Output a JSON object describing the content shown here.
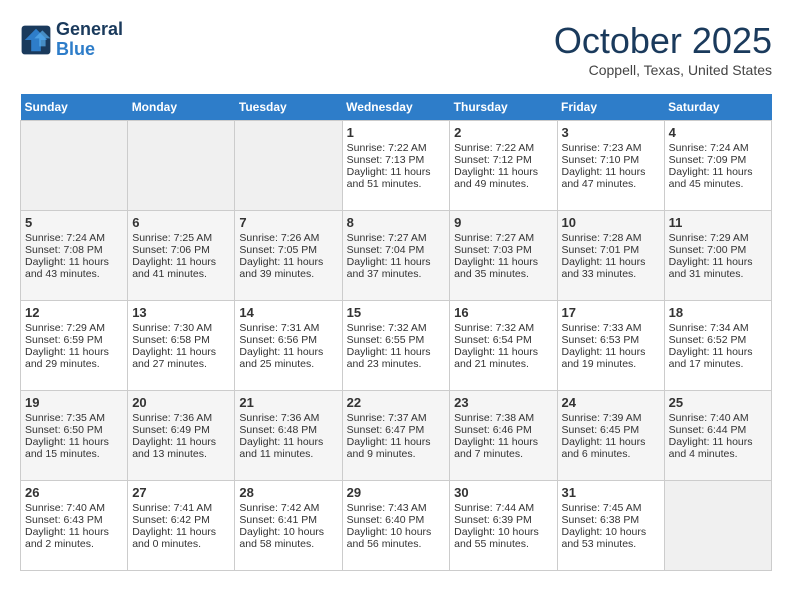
{
  "header": {
    "logo_line1": "General",
    "logo_line2": "Blue",
    "month": "October 2025",
    "location": "Coppell, Texas, United States"
  },
  "weekdays": [
    "Sunday",
    "Monday",
    "Tuesday",
    "Wednesday",
    "Thursday",
    "Friday",
    "Saturday"
  ],
  "weeks": [
    [
      {
        "day": "",
        "info": ""
      },
      {
        "day": "",
        "info": ""
      },
      {
        "day": "",
        "info": ""
      },
      {
        "day": "1",
        "info": "Sunrise: 7:22 AM\nSunset: 7:13 PM\nDaylight: 11 hours and 51 minutes."
      },
      {
        "day": "2",
        "info": "Sunrise: 7:22 AM\nSunset: 7:12 PM\nDaylight: 11 hours and 49 minutes."
      },
      {
        "day": "3",
        "info": "Sunrise: 7:23 AM\nSunset: 7:10 PM\nDaylight: 11 hours and 47 minutes."
      },
      {
        "day": "4",
        "info": "Sunrise: 7:24 AM\nSunset: 7:09 PM\nDaylight: 11 hours and 45 minutes."
      }
    ],
    [
      {
        "day": "5",
        "info": "Sunrise: 7:24 AM\nSunset: 7:08 PM\nDaylight: 11 hours and 43 minutes."
      },
      {
        "day": "6",
        "info": "Sunrise: 7:25 AM\nSunset: 7:06 PM\nDaylight: 11 hours and 41 minutes."
      },
      {
        "day": "7",
        "info": "Sunrise: 7:26 AM\nSunset: 7:05 PM\nDaylight: 11 hours and 39 minutes."
      },
      {
        "day": "8",
        "info": "Sunrise: 7:27 AM\nSunset: 7:04 PM\nDaylight: 11 hours and 37 minutes."
      },
      {
        "day": "9",
        "info": "Sunrise: 7:27 AM\nSunset: 7:03 PM\nDaylight: 11 hours and 35 minutes."
      },
      {
        "day": "10",
        "info": "Sunrise: 7:28 AM\nSunset: 7:01 PM\nDaylight: 11 hours and 33 minutes."
      },
      {
        "day": "11",
        "info": "Sunrise: 7:29 AM\nSunset: 7:00 PM\nDaylight: 11 hours and 31 minutes."
      }
    ],
    [
      {
        "day": "12",
        "info": "Sunrise: 7:29 AM\nSunset: 6:59 PM\nDaylight: 11 hours and 29 minutes."
      },
      {
        "day": "13",
        "info": "Sunrise: 7:30 AM\nSunset: 6:58 PM\nDaylight: 11 hours and 27 minutes."
      },
      {
        "day": "14",
        "info": "Sunrise: 7:31 AM\nSunset: 6:56 PM\nDaylight: 11 hours and 25 minutes."
      },
      {
        "day": "15",
        "info": "Sunrise: 7:32 AM\nSunset: 6:55 PM\nDaylight: 11 hours and 23 minutes."
      },
      {
        "day": "16",
        "info": "Sunrise: 7:32 AM\nSunset: 6:54 PM\nDaylight: 11 hours and 21 minutes."
      },
      {
        "day": "17",
        "info": "Sunrise: 7:33 AM\nSunset: 6:53 PM\nDaylight: 11 hours and 19 minutes."
      },
      {
        "day": "18",
        "info": "Sunrise: 7:34 AM\nSunset: 6:52 PM\nDaylight: 11 hours and 17 minutes."
      }
    ],
    [
      {
        "day": "19",
        "info": "Sunrise: 7:35 AM\nSunset: 6:50 PM\nDaylight: 11 hours and 15 minutes."
      },
      {
        "day": "20",
        "info": "Sunrise: 7:36 AM\nSunset: 6:49 PM\nDaylight: 11 hours and 13 minutes."
      },
      {
        "day": "21",
        "info": "Sunrise: 7:36 AM\nSunset: 6:48 PM\nDaylight: 11 hours and 11 minutes."
      },
      {
        "day": "22",
        "info": "Sunrise: 7:37 AM\nSunset: 6:47 PM\nDaylight: 11 hours and 9 minutes."
      },
      {
        "day": "23",
        "info": "Sunrise: 7:38 AM\nSunset: 6:46 PM\nDaylight: 11 hours and 7 minutes."
      },
      {
        "day": "24",
        "info": "Sunrise: 7:39 AM\nSunset: 6:45 PM\nDaylight: 11 hours and 6 minutes."
      },
      {
        "day": "25",
        "info": "Sunrise: 7:40 AM\nSunset: 6:44 PM\nDaylight: 11 hours and 4 minutes."
      }
    ],
    [
      {
        "day": "26",
        "info": "Sunrise: 7:40 AM\nSunset: 6:43 PM\nDaylight: 11 hours and 2 minutes."
      },
      {
        "day": "27",
        "info": "Sunrise: 7:41 AM\nSunset: 6:42 PM\nDaylight: 11 hours and 0 minutes."
      },
      {
        "day": "28",
        "info": "Sunrise: 7:42 AM\nSunset: 6:41 PM\nDaylight: 10 hours and 58 minutes."
      },
      {
        "day": "29",
        "info": "Sunrise: 7:43 AM\nSunset: 6:40 PM\nDaylight: 10 hours and 56 minutes."
      },
      {
        "day": "30",
        "info": "Sunrise: 7:44 AM\nSunset: 6:39 PM\nDaylight: 10 hours and 55 minutes."
      },
      {
        "day": "31",
        "info": "Sunrise: 7:45 AM\nSunset: 6:38 PM\nDaylight: 10 hours and 53 minutes."
      },
      {
        "day": "",
        "info": ""
      }
    ]
  ]
}
